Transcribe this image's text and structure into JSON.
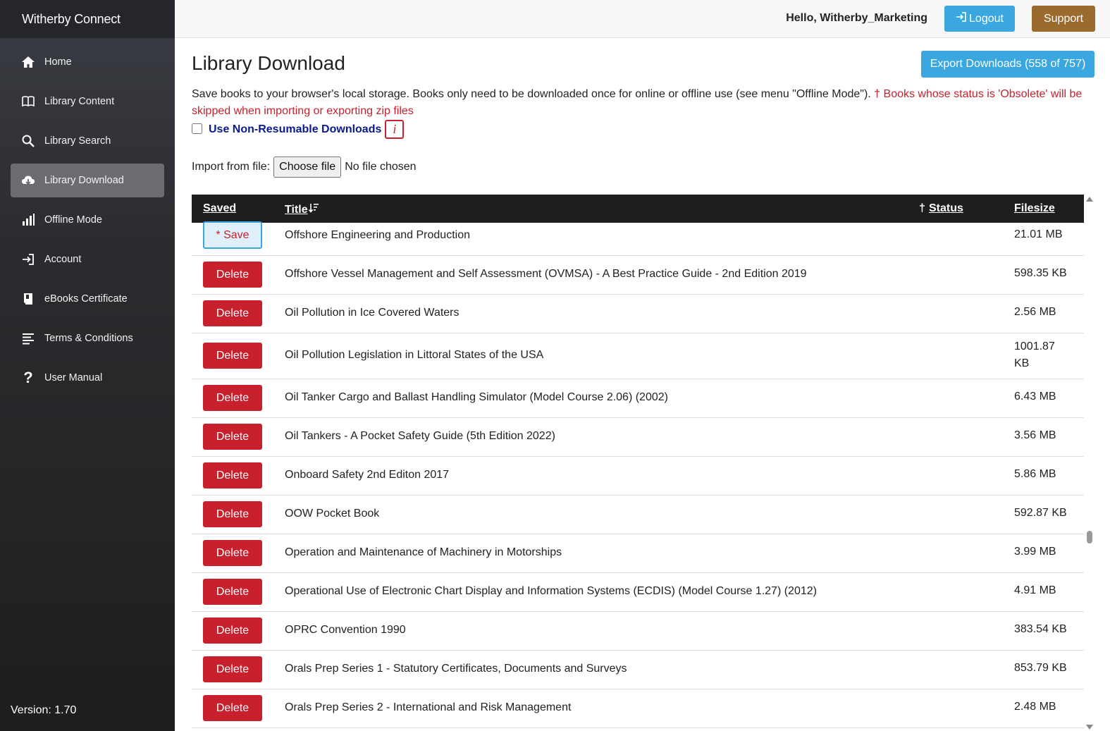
{
  "app": {
    "brand": "Witherby Connect",
    "version": "Version: 1.70"
  },
  "sidebar": {
    "items": [
      {
        "label": "Home",
        "icon": "home-icon",
        "active": false
      },
      {
        "label": "Library Content",
        "icon": "book-icon",
        "active": false
      },
      {
        "label": "Library Search",
        "icon": "search-icon",
        "active": false
      },
      {
        "label": "Library Download",
        "icon": "cloud-download-icon",
        "active": true
      },
      {
        "label": "Offline Mode",
        "icon": "signal-bars-icon",
        "active": false
      },
      {
        "label": "Account",
        "icon": "login-icon",
        "active": false
      },
      {
        "label": "eBooks Certificate",
        "icon": "certificate-icon",
        "active": false
      },
      {
        "label": "Terms & Conditions",
        "icon": "list-icon",
        "active": false
      },
      {
        "label": "User Manual",
        "icon": "question-icon",
        "active": false
      }
    ]
  },
  "header": {
    "greeting": "Hello, Witherby_Marketing",
    "logout_label": "Logout",
    "support_label": "Support"
  },
  "main": {
    "title": "Library Download",
    "export_label": "Export Downloads (558 of 757)",
    "intro_text": "Save books to your browser's local storage. Books only need to be downloaded once for online or offline use (see menu \"Offline Mode\"). ",
    "intro_warning": "† Books whose status is 'Obsolete' will be skipped when importing or exporting zip files",
    "nonresumable_label": "Use Non-Resumable Downloads",
    "nonresumable_checked": false,
    "info_glyph": "i",
    "import_label": "Import from file:",
    "choose_file_label": "Choose file",
    "no_file_text": "No file chosen"
  },
  "table": {
    "columns": {
      "saved": "Saved",
      "title": "Title",
      "status_dagger": "†",
      "status": "Status",
      "filesize": "Filesize"
    },
    "rows": [
      {
        "action": "* Save",
        "type": "save",
        "title": "Offshore Engineering and Production",
        "size": "21.01 MB"
      },
      {
        "action": "Delete",
        "type": "delete",
        "title": "Offshore Vessel Management and Self Assessment (OVMSA) - A Best Practice Guide - 2nd Edition 2019",
        "size": "598.35 KB"
      },
      {
        "action": "Delete",
        "type": "delete",
        "title": "Oil Pollution in Ice Covered Waters",
        "size": "2.56 MB"
      },
      {
        "action": "Delete",
        "type": "delete",
        "title": "Oil Pollution Legislation in Littoral States of the USA",
        "size": "1001.87 KB"
      },
      {
        "action": "Delete",
        "type": "delete",
        "title": "Oil Tanker Cargo and Ballast Handling Simulator (Model Course 2.06) (2002)",
        "size": "6.43 MB"
      },
      {
        "action": "Delete",
        "type": "delete",
        "title": "Oil Tankers - A Pocket Safety Guide (5th Edition 2022)",
        "size": "3.56 MB"
      },
      {
        "action": "Delete",
        "type": "delete",
        "title": "Onboard Safety 2nd Editon 2017",
        "size": "5.86 MB"
      },
      {
        "action": "Delete",
        "type": "delete",
        "title": "OOW Pocket Book",
        "size": "592.87 KB"
      },
      {
        "action": "Delete",
        "type": "delete",
        "title": "Operation and Maintenance of Machinery in Motorships",
        "size": "3.99 MB"
      },
      {
        "action": "Delete",
        "type": "delete",
        "title": "Operational Use of Electronic Chart Display and Information Systems (ECDIS) (Model Course 1.27) (2012)",
        "size": "4.91 MB"
      },
      {
        "action": "Delete",
        "type": "delete",
        "title": "OPRC Convention 1990",
        "size": "383.54 KB"
      },
      {
        "action": "Delete",
        "type": "delete",
        "title": "Orals Prep Series 1 - Statutory Certificates, Documents and Surveys",
        "size": "853.79 KB"
      },
      {
        "action": "Delete",
        "type": "delete",
        "title": "Orals Prep Series 2 - International and Risk Management",
        "size": "2.48 MB"
      }
    ]
  },
  "colors": {
    "accent": "#3aa7e0",
    "danger": "#c8202d",
    "support": "#9b6a2d",
    "sidebar": "#2b2b2f"
  }
}
